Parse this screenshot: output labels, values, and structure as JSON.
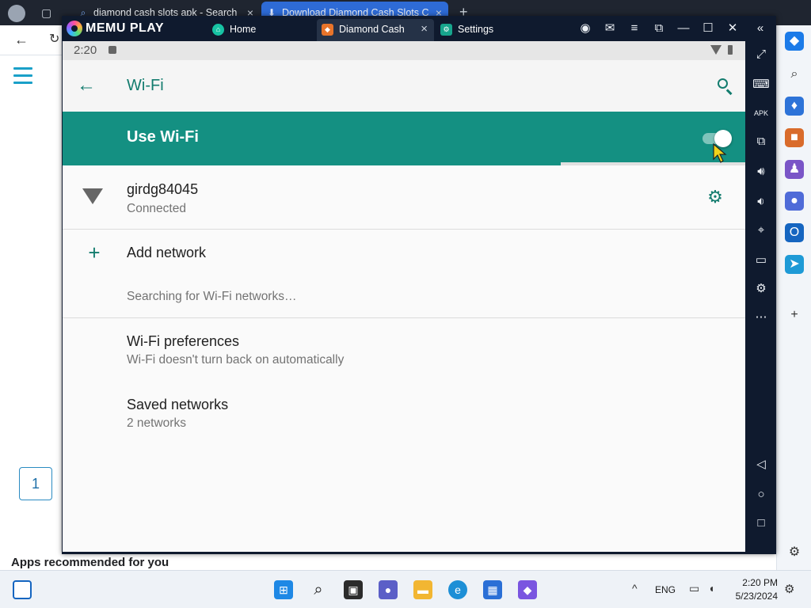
{
  "browser": {
    "tabs": [
      {
        "label": "diamond cash slots apk - Search",
        "icon": "search-icon"
      },
      {
        "label": "Download Diamond Cash Slots C",
        "icon": "download-icon"
      }
    ],
    "page": {
      "page_number": "1",
      "apps_heading": "Apps recommended for you"
    }
  },
  "memu": {
    "logo_text": "MEMU PLAY",
    "tabs": [
      {
        "label": "Home"
      },
      {
        "label": "Diamond Cash"
      },
      {
        "label": "Settings"
      }
    ]
  },
  "android": {
    "status_time": "2:20",
    "app_title": "Wi-Fi",
    "use_wifi_label": "Use Wi-Fi",
    "wifi_enabled": true,
    "scan_progress_fraction": 0.73,
    "connected_network": {
      "name": "girdg84045",
      "status": "Connected"
    },
    "add_network_label": "Add network",
    "searching_text": "Searching for Wi-Fi networks…",
    "preferences": {
      "title": "Wi-Fi preferences",
      "subtitle": "Wi-Fi doesn't turn back on automatically"
    },
    "saved_networks": {
      "title": "Saved networks",
      "subtitle": "2 networks"
    },
    "accent_color": "#149082"
  },
  "taskbar": {
    "language": "ENG",
    "time": "2:20 PM",
    "date": "5/23/2024"
  }
}
